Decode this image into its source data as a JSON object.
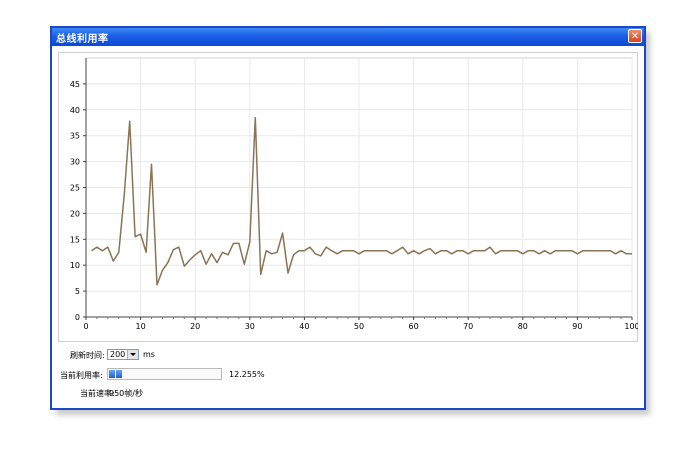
{
  "window": {
    "title": "总线利用率"
  },
  "controls": {
    "refresh_label": "刷新时间:",
    "refresh_value": "200",
    "refresh_unit": "ms",
    "utilization_label": "当前利用率:",
    "utilization_value": "12.255%",
    "utilization_fraction": 0.12255,
    "rate_label": "当前速率:",
    "rate_value": "950帧/秒"
  },
  "colors": {
    "line": "#8c7356",
    "titlebar": "#1b5fe6",
    "grid": "#e8e8e8"
  },
  "icons": {
    "close": "close-icon",
    "dropdown": "chevron-down-icon"
  },
  "chart_data": {
    "type": "line",
    "xlim": [
      0,
      100
    ],
    "ylim": [
      0,
      50
    ],
    "xticks": [
      0,
      10,
      20,
      30,
      40,
      50,
      60,
      70,
      80,
      90,
      100
    ],
    "yticks": [
      0,
      5,
      10,
      15,
      20,
      25,
      30,
      35,
      40,
      45
    ],
    "grid": true,
    "series": [
      {
        "x": [
          1,
          2,
          3,
          4,
          5,
          6,
          7,
          8,
          9,
          10,
          11,
          12,
          13,
          14,
          15,
          16,
          17,
          18,
          19,
          20,
          21,
          22,
          23,
          24,
          25,
          26,
          27,
          28,
          29,
          30,
          31,
          32,
          33,
          34,
          35,
          36,
          37,
          38,
          39,
          40,
          41,
          42,
          43,
          44,
          45,
          46,
          47,
          48,
          49,
          50,
          51,
          52,
          53,
          54,
          55,
          56,
          57,
          58,
          59,
          60,
          61,
          62,
          63,
          64,
          65,
          66,
          67,
          68,
          69,
          70,
          71,
          72,
          73,
          74,
          75,
          76,
          77,
          78,
          79,
          80,
          81,
          82,
          83,
          84,
          85,
          86,
          87,
          88,
          89,
          90,
          91,
          92,
          93,
          94,
          95,
          96,
          97,
          98,
          99,
          100
        ],
        "y": [
          12.8,
          13.5,
          12.8,
          13.5,
          10.8,
          12.5,
          23.5,
          37.8,
          15.5,
          16.0,
          12.5,
          29.5,
          6.2,
          9.0,
          10.5,
          13.0,
          13.5,
          9.8,
          11.0,
          12.0,
          12.8,
          10.2,
          12.2,
          10.5,
          12.5,
          12.0,
          14.2,
          14.2,
          10.2,
          14.5,
          38.5,
          8.2,
          12.8,
          12.2,
          12.5,
          16.2,
          8.5,
          12.0,
          12.8,
          12.8,
          13.5,
          12.2,
          11.8,
          13.5,
          12.8,
          12.2,
          12.8,
          12.8,
          12.8,
          12.2,
          12.8,
          12.8,
          12.8,
          12.8,
          12.8,
          12.2,
          12.8,
          13.5,
          12.2,
          12.8,
          12.2,
          12.8,
          13.2,
          12.2,
          12.8,
          12.8,
          12.2,
          12.8,
          12.8,
          12.2,
          12.8,
          12.8,
          12.8,
          13.5,
          12.2,
          12.8,
          12.8,
          12.8,
          12.8,
          12.2,
          12.8,
          12.8,
          12.2,
          12.8,
          12.2,
          12.8,
          12.8,
          12.8,
          12.8,
          12.2,
          12.8,
          12.8,
          12.8,
          12.8,
          12.8,
          12.8,
          12.2,
          12.8,
          12.2,
          12.2
        ]
      }
    ]
  }
}
